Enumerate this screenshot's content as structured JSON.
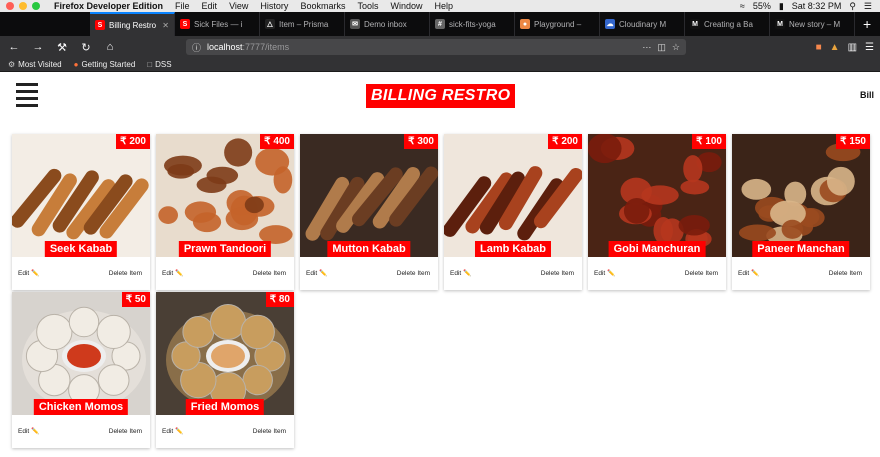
{
  "os": {
    "app_name": "Firefox Developer Edition",
    "menus": [
      "File",
      "Edit",
      "View",
      "History",
      "Bookmarks",
      "Tools",
      "Window",
      "Help"
    ],
    "battery": "55%",
    "clock": "Sat 8:32 PM"
  },
  "tabs": [
    {
      "title": "Billing Restro",
      "favicon": "S",
      "color": "#ff0000",
      "active": true
    },
    {
      "title": "Sick Files — i",
      "favicon": "S",
      "color": "#ff0000"
    },
    {
      "title": "Item – Prisma",
      "favicon": "△",
      "color": "#222"
    },
    {
      "title": "Demo inbox",
      "favicon": "✉",
      "color": "#555"
    },
    {
      "title": "sick-fits-yoga",
      "favicon": "#",
      "color": "#666"
    },
    {
      "title": "Playground –",
      "favicon": "●",
      "color": "#e84"
    },
    {
      "title": "Cloudinary M",
      "favicon": "☁",
      "color": "#36c"
    },
    {
      "title": "Creating a Ba",
      "favicon": "M",
      "color": "#111"
    },
    {
      "title": "New story – M",
      "favicon": "M",
      "color": "#111"
    }
  ],
  "url": {
    "host": "localhost",
    "rest": ":7777/items"
  },
  "bookmarks": [
    "Most Visited",
    "Getting Started",
    "DSS"
  ],
  "app": {
    "logo": "BILLING RESTRO",
    "bill_label": "Bill",
    "edit_label": "Edit ✏️",
    "delete_label": "Delete Item"
  },
  "items": [
    {
      "name": "Seek Kabab",
      "price": "₹ 200",
      "colors": [
        "#f3ede5",
        "#c77d3a",
        "#8a4b1d"
      ],
      "pattern": "sticks"
    },
    {
      "name": "Prawn Tandoori",
      "price": "₹ 400",
      "colors": [
        "#e8dccd",
        "#c4632a",
        "#7d3b17"
      ],
      "pattern": "blobs"
    },
    {
      "name": "Mutton Kabab",
      "price": "₹ 300",
      "colors": [
        "#3a2a22",
        "#6b3d22",
        "#b07b4b"
      ],
      "pattern": "sticks"
    },
    {
      "name": "Lamb Kabab",
      "price": "₹ 200",
      "colors": [
        "#efe6dc",
        "#a8421e",
        "#5c1f0d"
      ],
      "pattern": "sticks"
    },
    {
      "name": "Gobi Manchuran",
      "price": "₹ 100",
      "colors": [
        "#4a2415",
        "#b6361e",
        "#7a1c0c"
      ],
      "pattern": "blobs"
    },
    {
      "name": "Paneer Manchan",
      "price": "₹ 150",
      "colors": [
        "#3b2418",
        "#9a4a1f",
        "#d9b68a"
      ],
      "pattern": "blobs"
    },
    {
      "name": "Chicken Momos",
      "price": "₹ 50",
      "colors": [
        "#d7d3ce",
        "#f1ece4",
        "#cf3a1c"
      ],
      "pattern": "momos"
    },
    {
      "name": "Fried Momos",
      "price": "₹ 80",
      "colors": [
        "#4a3f35",
        "#c89d5e",
        "#e0a56a"
      ],
      "pattern": "momos"
    }
  ]
}
